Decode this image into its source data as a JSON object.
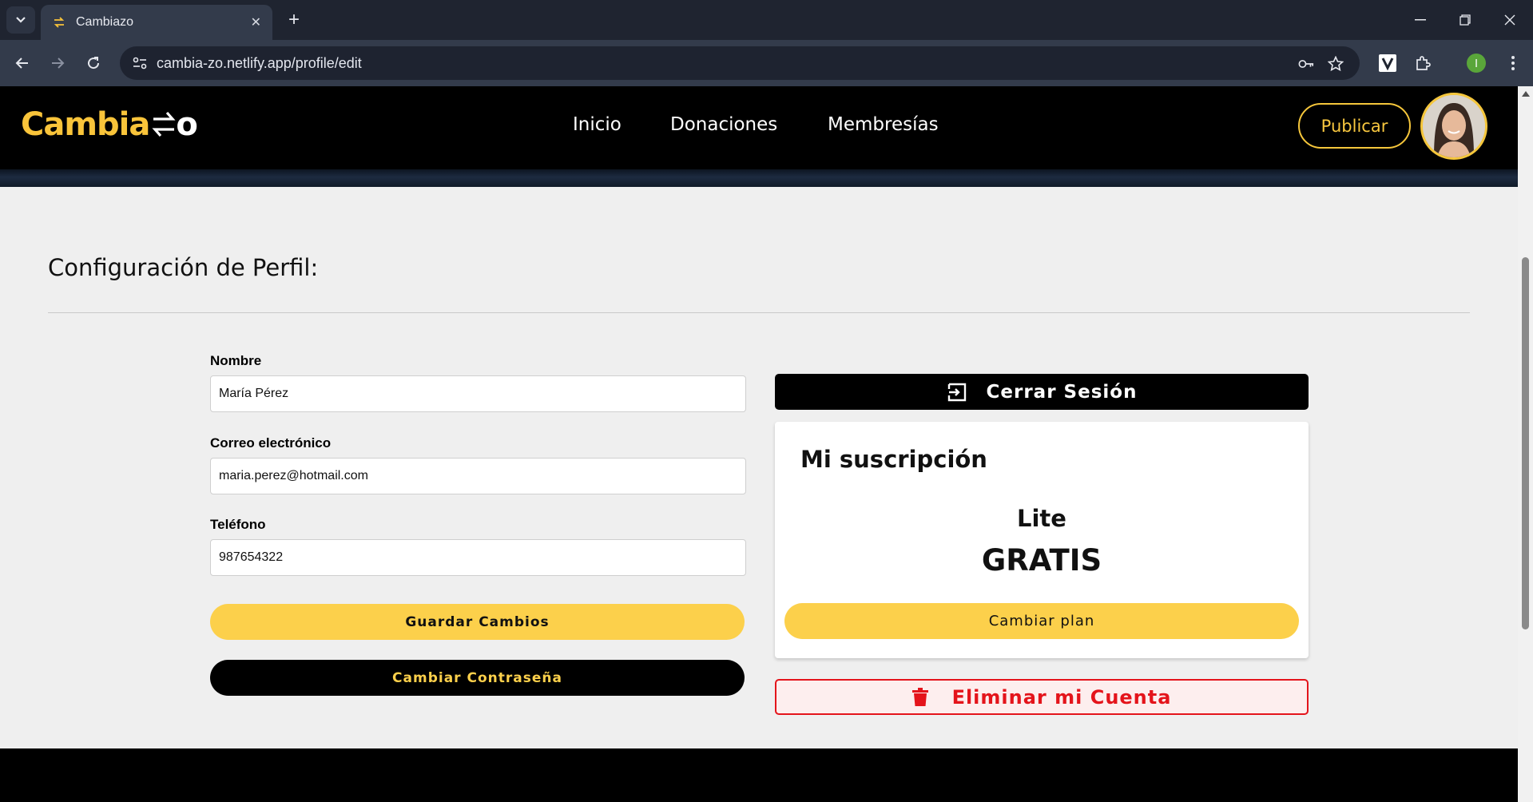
{
  "browser": {
    "tab_title": "Cambiazo",
    "url": "cambia-zo.netlify.app/profile/edit",
    "profile_initial": "I"
  },
  "site": {
    "logo_text": "Cambia",
    "logo_suffix": "o",
    "nav": [
      "Inicio",
      "Donaciones",
      "Membresías"
    ],
    "publish_label": "Publicar"
  },
  "profile": {
    "page_title": "Configuración de Perfil:",
    "name_label": "Nombre",
    "name_value": "María Pérez",
    "email_label": "Correo electrónico",
    "email_value": "maria.perez@hotmail.com",
    "phone_label": "Teléfono",
    "phone_value": "987654322",
    "save_label": "Guardar Cambios",
    "change_password_label": "Cambiar Contraseña"
  },
  "account": {
    "logout_label": "Cerrar Sesión",
    "subscription_title": "Mi suscripción",
    "plan_name": "Lite",
    "plan_price": "GRATIS",
    "change_plan_label": "Cambiar plan",
    "delete_label": "Eliminar mi Cuenta"
  },
  "colors": {
    "brand_yellow": "#fcd04b",
    "danger_red": "#e4141b",
    "chrome_dark": "#1f2430"
  }
}
